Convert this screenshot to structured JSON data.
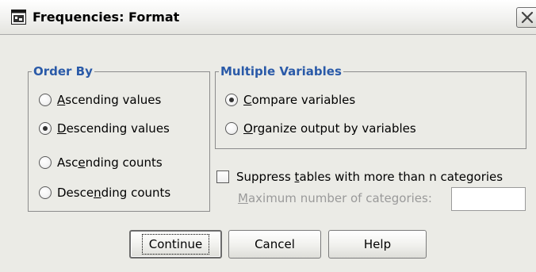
{
  "window": {
    "title": "Frequencies: Format"
  },
  "order_by": {
    "title": "Order By",
    "options": [
      {
        "pre": "",
        "mnemonic": "A",
        "post": "scending values",
        "checked": false
      },
      {
        "pre": "",
        "mnemonic": "D",
        "post": "escending values",
        "checked": true
      },
      {
        "pre": "Asc",
        "mnemonic": "e",
        "post": "nding counts",
        "checked": false
      },
      {
        "pre": "Desce",
        "mnemonic": "n",
        "post": "ding counts",
        "checked": false
      }
    ]
  },
  "multiple_variables": {
    "title": "Multiple Variables",
    "options": [
      {
        "pre": "",
        "mnemonic": "C",
        "post": "ompare variables",
        "checked": true
      },
      {
        "pre": "",
        "mnemonic": "O",
        "post": "rganize output by variables",
        "checked": false
      }
    ]
  },
  "suppress": {
    "label_pre": "Suppress ",
    "label_mnemonic": "t",
    "label_post": "ables with more than n categories",
    "checked": false,
    "max_label_mnemonic": "M",
    "max_label_rest": "aximum number of categories:",
    "max_value": ""
  },
  "buttons": {
    "continue": "Continue",
    "cancel": "Cancel",
    "help": "Help"
  },
  "icons": {
    "app": "spss-window-icon",
    "close": "close-icon"
  },
  "colors": {
    "group_title": "#2a5aa8",
    "dialog_bg": "#ebebe6",
    "disabled_text": "#9a9a9a"
  }
}
